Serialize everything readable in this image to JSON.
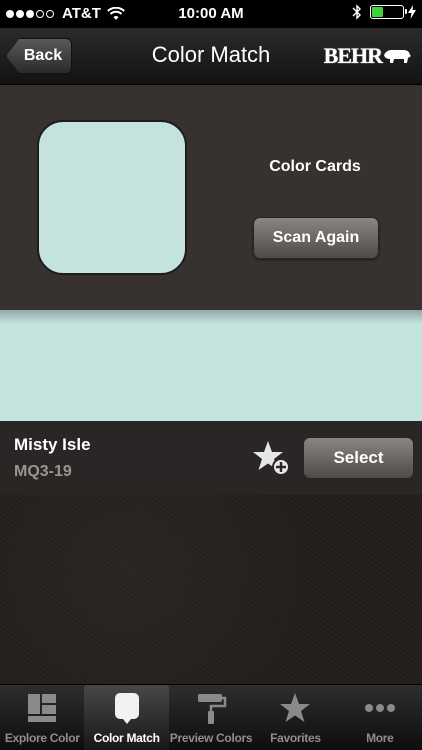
{
  "status_bar": {
    "carrier": "AT&T",
    "time": "10:00 AM",
    "battery_level": 0.35,
    "battery_color": "#3fd23a"
  },
  "nav": {
    "back_label": "Back",
    "title": "Color Match",
    "brand": "BEHR"
  },
  "match": {
    "color_cards_label": "Color Cards",
    "scan_again_label": "Scan Again",
    "swatch_color": "#c4e3df"
  },
  "result": {
    "color_name": "Misty Isle",
    "color_code": "MQ3-19",
    "select_label": "Select",
    "favorite_icon": "star-add-icon"
  },
  "tabs": [
    {
      "label": "Explore Color",
      "icon": "explore-color-icon",
      "active": false
    },
    {
      "label": "Color Match",
      "icon": "color-match-icon",
      "active": true
    },
    {
      "label": "Preview Colors",
      "icon": "paint-roller-icon",
      "active": false
    },
    {
      "label": "Favorites",
      "icon": "star-icon",
      "active": false
    },
    {
      "label": "More",
      "icon": "more-dots-icon",
      "active": false
    }
  ]
}
